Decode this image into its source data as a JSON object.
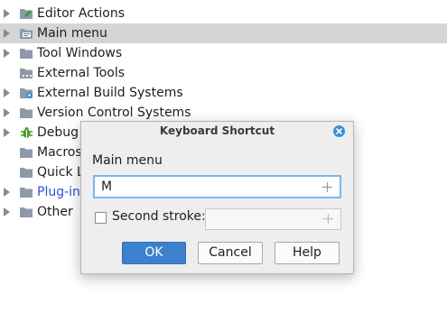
{
  "tree": {
    "items": [
      {
        "label": "Editor Actions",
        "icon": "folder-pencil-icon",
        "arrow": true,
        "selected": false
      },
      {
        "label": "Main menu",
        "icon": "folder-menu-icon",
        "arrow": true,
        "selected": true
      },
      {
        "label": "Tool Windows",
        "icon": "folder-icon",
        "arrow": true,
        "selected": false
      },
      {
        "label": "External Tools",
        "icon": "folder-dots-icon",
        "arrow": false,
        "selected": false
      },
      {
        "label": "External Build Systems",
        "icon": "folder-gear-icon",
        "arrow": true,
        "selected": false
      },
      {
        "label": "Version Control Systems",
        "icon": "folder-icon",
        "arrow": true,
        "selected": false
      },
      {
        "label": "Debug",
        "icon": "bug-icon",
        "arrow": true,
        "selected": false
      },
      {
        "label": "Macros",
        "icon": "folder-icon",
        "arrow": false,
        "selected": false
      },
      {
        "label": "Quick L",
        "icon": "folder-icon",
        "arrow": false,
        "selected": false
      },
      {
        "label": "Plug-in",
        "icon": "folder-icon",
        "arrow": true,
        "selected": false,
        "link": true
      },
      {
        "label": "Other",
        "icon": "folder-icon",
        "arrow": true,
        "selected": false
      }
    ]
  },
  "dialog": {
    "title": "Keyboard Shortcut",
    "heading": "Main menu",
    "first_stroke_value": "M",
    "second_stroke_label": "Second stroke:",
    "second_stroke_checked": false,
    "buttons": {
      "ok": "OK",
      "cancel": "Cancel",
      "help": "Help"
    }
  },
  "colors": {
    "selection": "#d5d5d5",
    "accent": "#3d80cc",
    "focus_border": "#7eb4ea",
    "link": "#2b50d9"
  }
}
